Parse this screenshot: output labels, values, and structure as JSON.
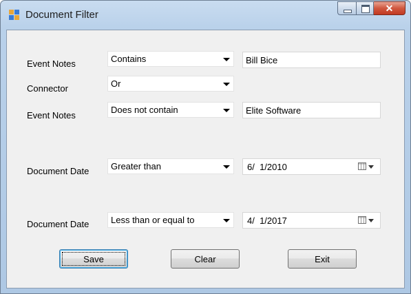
{
  "window": {
    "title": "Document Filter"
  },
  "rows": [
    {
      "label": "Event Notes",
      "operator": "Contains",
      "value": "Bill Bice"
    },
    {
      "label": "Connector",
      "operator": "Or"
    },
    {
      "label": "Event Notes",
      "operator": "Does not contain",
      "value": "Elite Software"
    },
    {
      "label": "Document Date",
      "operator": "Greater than",
      "date": "6/  1/2010"
    },
    {
      "label": "Document Date",
      "operator": "Less than or equal to",
      "date": "4/  1/2017"
    }
  ],
  "buttons": {
    "save": "Save",
    "clear": "Clear",
    "exit": "Exit"
  },
  "icons": {
    "app": "app-grid-icon",
    "minimize": "minimize-icon",
    "maximize": "maximize-icon",
    "close": "close-icon",
    "calendar": "calendar-icon",
    "dropdown": "chevron-down-icon"
  },
  "colors": {
    "title_bar": "#b9d1ea",
    "client_bg": "#f0f0f0",
    "close_button": "#c13a22",
    "default_button_border": "#3c7fb1"
  }
}
